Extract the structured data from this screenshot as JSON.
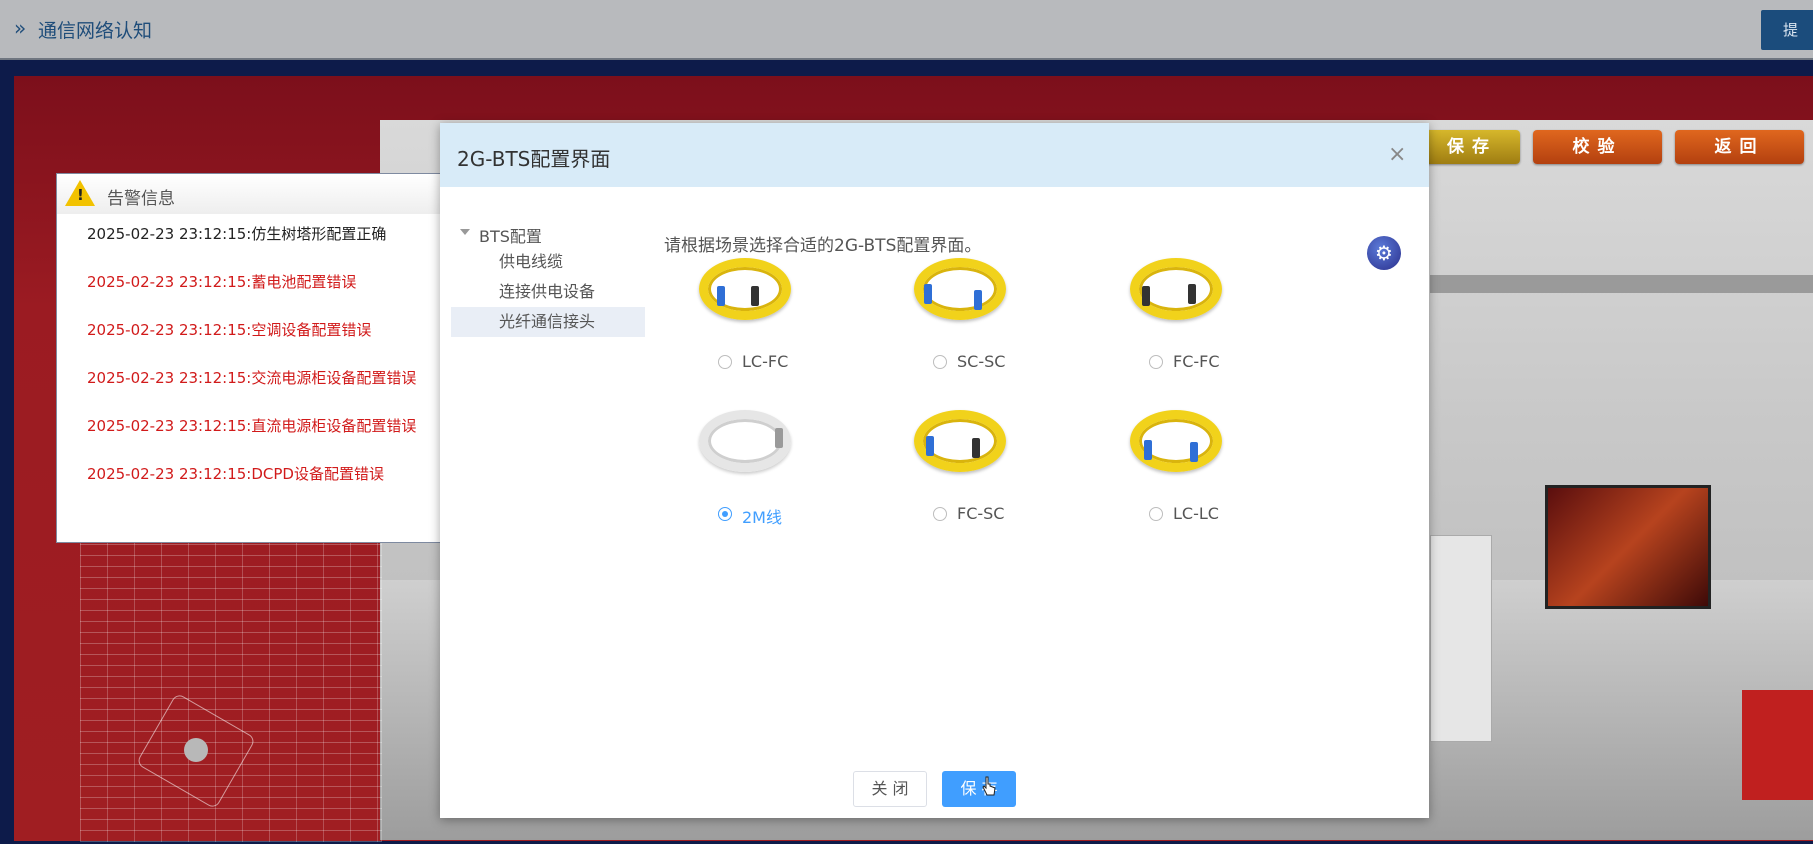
{
  "topbar": {
    "chevron": "»",
    "title": "通信网络认知",
    "submit_label": "提"
  },
  "scene_buttons": {
    "save": "保存",
    "check": "校验",
    "back": "返回"
  },
  "alarm": {
    "title": "告警信息",
    "icon": "warning-icon",
    "messages": [
      {
        "text": "2025-02-23 23:12:15:仿生树塔形配置正确",
        "level": "ok"
      },
      {
        "text": "2025-02-23 23:12:15:蓄电池配置错误",
        "level": "err"
      },
      {
        "text": "2025-02-23 23:12:15:空调设备配置错误",
        "level": "err"
      },
      {
        "text": "2025-02-23 23:12:15:交流电源柜设备配置错误",
        "level": "err"
      },
      {
        "text": "2025-02-23 23:12:15:直流电源柜设备配置错误",
        "level": "err"
      },
      {
        "text": "2025-02-23 23:12:15:DCPD设备配置错误",
        "level": "err"
      }
    ]
  },
  "modal": {
    "title": "2G-BTS配置界面",
    "close_icon": "close-icon",
    "tree": {
      "root": "BTS配置",
      "items": [
        "供电线缆",
        "连接供电设备",
        "光纤通信接头"
      ],
      "active_index": 2
    },
    "description": "请根据场景选择合适的2G-BTS配置界面。",
    "options": [
      {
        "label": "LC-FC",
        "checked": false,
        "cable": "yellow"
      },
      {
        "label": "SC-SC",
        "checked": false,
        "cable": "yellow"
      },
      {
        "label": "FC-FC",
        "checked": false,
        "cable": "yellow"
      },
      {
        "label": "2M线",
        "checked": true,
        "cable": "white"
      },
      {
        "label": "FC-SC",
        "checked": false,
        "cable": "yellow"
      },
      {
        "label": "LC-LC",
        "checked": false,
        "cable": "yellow"
      }
    ],
    "buttons": {
      "close": "关 闭",
      "save": "保 存"
    }
  },
  "colors": {
    "accent": "#409eff",
    "header_bg": "#d8ebf8",
    "error": "#d11a1a"
  }
}
